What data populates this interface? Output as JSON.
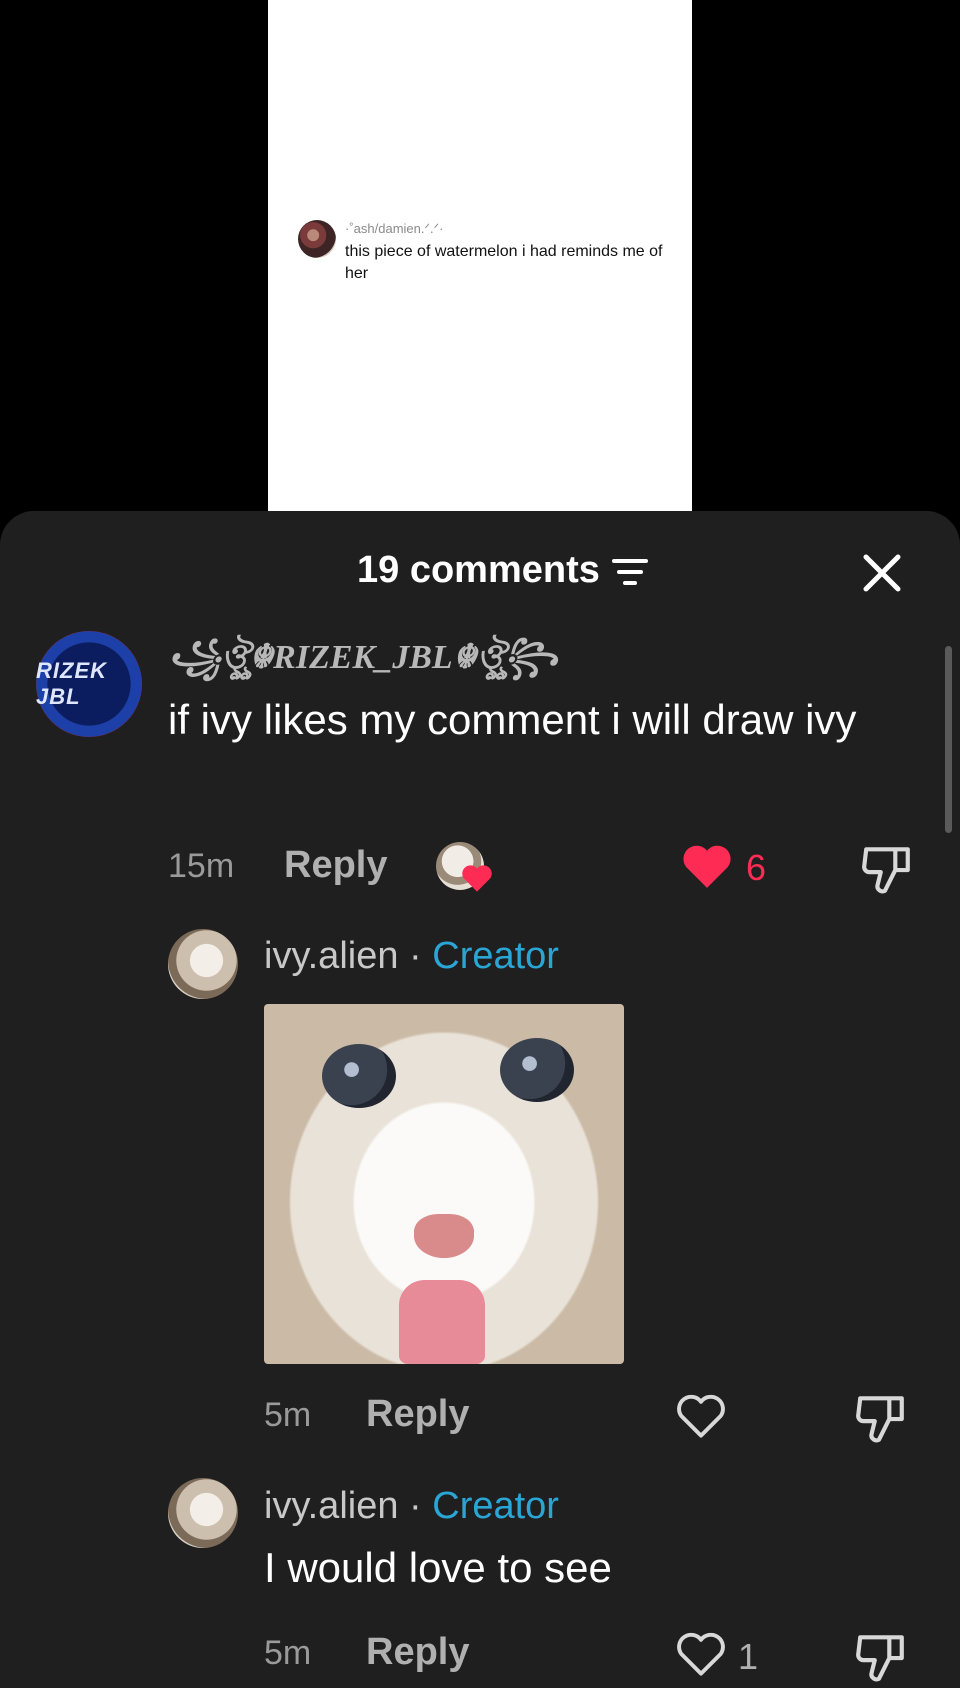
{
  "video": {
    "commenter": "·˚ash/damien.ᐟ.ᐟ·",
    "comment": "this piece of watermelon i had reminds me of her"
  },
  "sheet": {
    "count_label": "19 comments",
    "icons": {
      "filter": "filter-icon",
      "close": "close-icon"
    }
  },
  "comments": [
    {
      "username": "꧁ঔৣ☬RIZEK_JBL☬ঔৣ꧂",
      "avatar_text": "RIZEK JBL",
      "text": "if ivy likes my comment i will draw ivy",
      "time": "15m",
      "reply_label": "Reply",
      "likes": "6",
      "liked": true,
      "creator_liked": true
    },
    {
      "username": "ivy.alien",
      "badge": "Creator",
      "separator": " · ",
      "has_sticker": true,
      "time": "5m",
      "reply_label": "Reply",
      "likes": ""
    },
    {
      "username": "ivy.alien",
      "badge": "Creator",
      "separator": " · ",
      "text": "I would love to see",
      "time": "5m",
      "reply_label": "Reply",
      "likes": "1"
    }
  ],
  "colors": {
    "accent_like": "#fe2c55",
    "creator": "#2aa6d6",
    "sheet_bg": "#1f1f1f"
  }
}
